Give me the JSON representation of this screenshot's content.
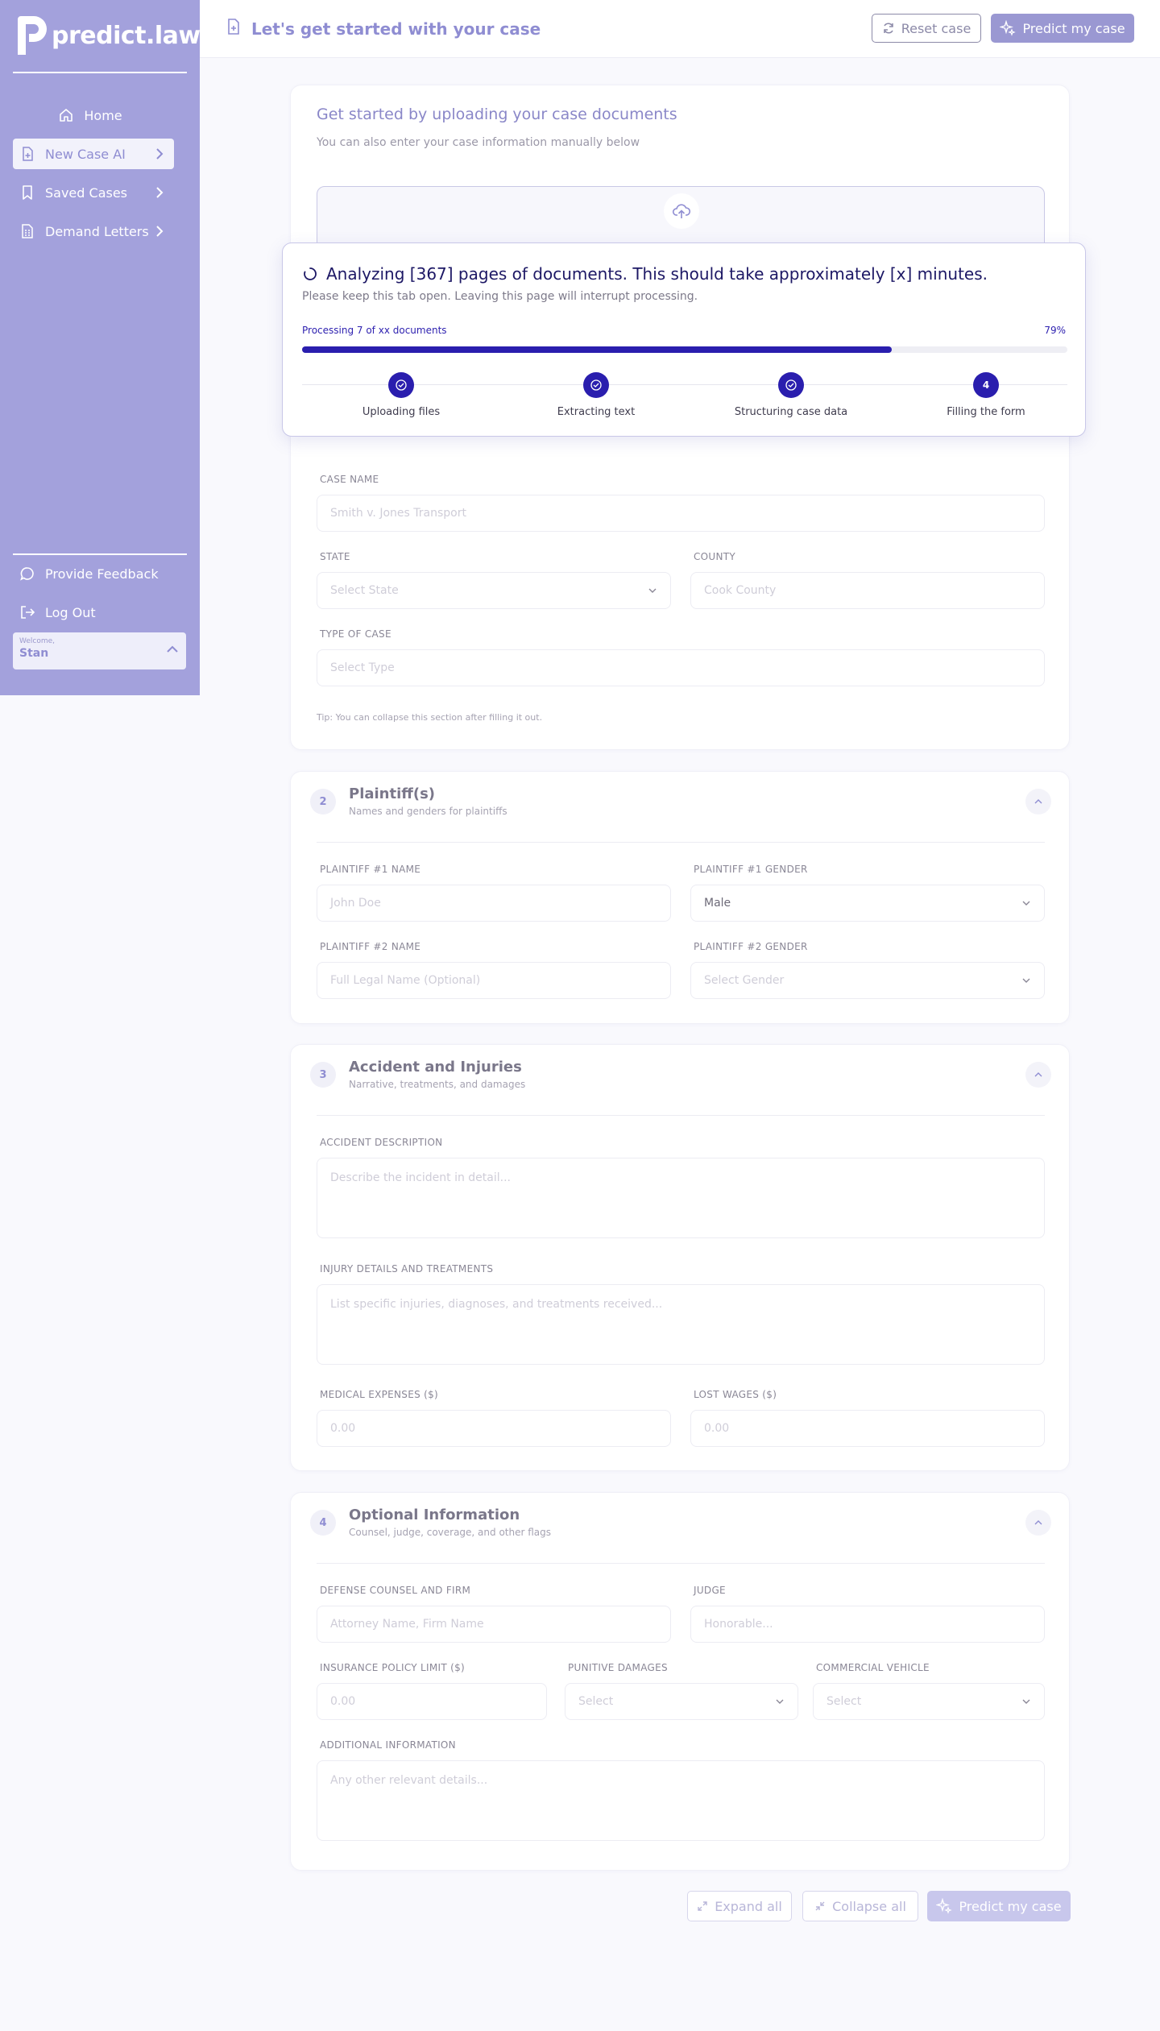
{
  "app": {
    "logo_text": "predict.law"
  },
  "sidebar": {
    "items": [
      {
        "label": "Home",
        "icon": "home-icon"
      },
      {
        "label": "New Case AI",
        "icon": "file-plus-icon"
      },
      {
        "label": "Saved Cases",
        "icon": "bookmark-icon"
      },
      {
        "label": "Demand Letters",
        "icon": "document-icon"
      }
    ],
    "footer": [
      {
        "label": "Provide Feedback",
        "icon": "chat-bubble-icon"
      },
      {
        "label": "Log Out",
        "icon": "logout-icon"
      }
    ],
    "welcome": {
      "caption": "Welcome,",
      "user": "Stan"
    }
  },
  "header": {
    "title": "Let's get started with your case",
    "reset_label": "Reset case",
    "predict_label": "Predict my case"
  },
  "upload": {
    "title": "Get started by uploading your case documents",
    "subtitle": "You can also enter your case information manually below"
  },
  "processing": {
    "title": "Analyzing [367] pages of documents. This should take approximately [x] minutes.",
    "subtitle": "Please keep this tab open. Leaving this page will interrupt processing.",
    "progress_label": "Processing 7 of xx documents",
    "percent_label": "79%",
    "progress": 0.77,
    "steps": [
      {
        "label": "Uploading files",
        "status": "done"
      },
      {
        "label": "Extracting text",
        "status": "done"
      },
      {
        "label": "Structuring case data",
        "status": "done"
      },
      {
        "label": "Filling the form",
        "status": "current",
        "number": "4"
      }
    ]
  },
  "case": {
    "name_label": "CASE NAME",
    "name_placeholder": "Smith v. Jones Transport",
    "state_label": "STATE",
    "state_placeholder": "Select State",
    "county_label": "COUNTY",
    "county_placeholder": "Cook County",
    "type_label": "TYPE OF CASE",
    "type_placeholder": "Select Type",
    "tip": "Tip: You can collapse this section after filling it out."
  },
  "plaintiffs": {
    "number": "2",
    "title": "Plaintiff(s)",
    "subtitle": "Names and genders for plaintiffs",
    "p1_name_label": "PLAINTIFF #1 NAME",
    "p1_name_placeholder": "John Doe",
    "p1_gender_label": "PLAINTIFF #1 GENDER",
    "p1_gender_value": "Male",
    "p2_name_label": "PLAINTIFF #2 NAME",
    "p2_name_placeholder": "Full Legal Name (Optional)",
    "p2_gender_label": "PLAINTIFF #2 GENDER",
    "p2_gender_placeholder": "Select Gender"
  },
  "accident": {
    "number": "3",
    "title": "Accident and Injuries",
    "subtitle": "Narrative, treatments, and damages",
    "desc_label": "ACCIDENT DESCRIPTION",
    "desc_placeholder": "Describe the incident in detail...",
    "injury_label": "INJURY DETAILS AND TREATMENTS",
    "injury_placeholder": "List specific injuries, diagnoses, and treatments received...",
    "medical_label": "MEDICAL EXPENSES ($)",
    "medical_placeholder": "0.00",
    "wages_label": "LOST WAGES ($)",
    "wages_placeholder": "0.00"
  },
  "optional": {
    "number": "4",
    "title": "Optional Information",
    "subtitle": "Counsel, judge, coverage, and other flags",
    "defense_label": "DEFENSE COUNSEL AND FIRM",
    "defense_placeholder": "Attorney Name, Firm Name",
    "judge_label": "JUDGE",
    "judge_placeholder": "Honorable...",
    "insurance_label": "INSURANCE POLICY LIMIT ($)",
    "insurance_placeholder": "0.00",
    "punitive_label": "PUNITIVE DAMAGES",
    "punitive_placeholder": "Select",
    "commercial_label": "COMMERCIAL VEHICLE",
    "commercial_placeholder": "Select",
    "additional_label": "ADDITIONAL INFORMATION",
    "additional_placeholder": "Any other relevant details..."
  },
  "footer_buttons": {
    "expand": "Expand all",
    "collapse": "Collapse all",
    "predict": "Predict my case"
  },
  "colors": {
    "sidebar": "#a3a1dc",
    "accent": "#2a1eae",
    "primary_text": "#8f8dd2"
  }
}
